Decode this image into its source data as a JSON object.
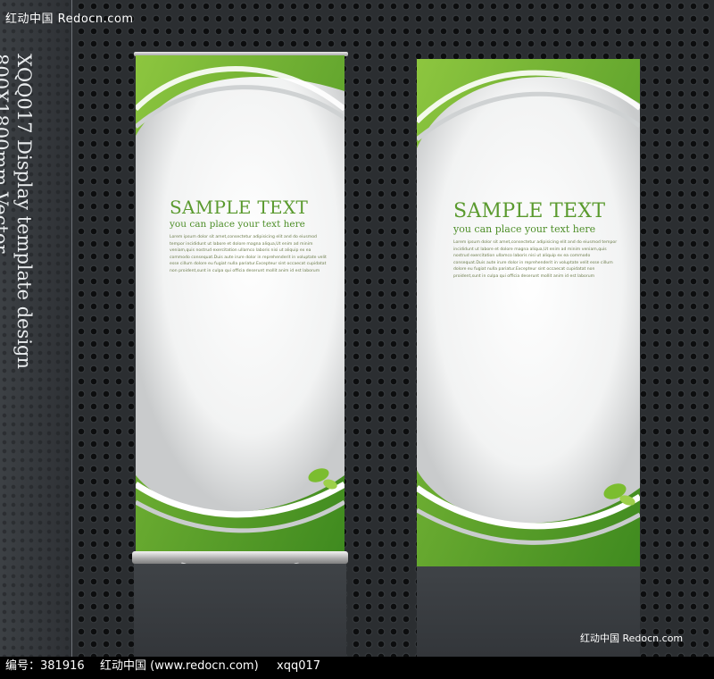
{
  "watermark_top": "红动中国 Redocn.com",
  "vertical_title": [
    "XQQ017 Display template design",
    "800X1800mm Vector"
  ],
  "banners": [
    {
      "title": "SAMPLE TEXT",
      "subtitle": "you can place your text here",
      "body": "Lorem ipsum dolor sit amet,consectetur adipisicing elit and do eiusmod tempor incididunt ut labore et dolore magna aliqua,Ut enim ad minim veniam,quis nostrud exercitation ullamco laboris nisi ut aliquip ex ea commodo consequat.Duis aute irure dolor in reprehenderit in voluptate velit esse cillum dolore eu fugiat nulla pariatur.Excepteur sint occaecat cupidatat non proident,sunt in culpa qui officia deserunt mollit anim id est laborum"
    },
    {
      "title": "SAMPLE TEXT",
      "subtitle": "you can place your text here",
      "body": "Lorem ipsum dolor sit amet,consectetur adipisicing elit and do eiusmod tempor incididunt ut labore et dolore magna aliqua,Ut enim ad minim veniam,quis nostrud exercitation ullamco laboris nisi ut aliquip ex ea commodo consequat.Duis aute irure dolor in reprehenderit in voluptate velit esse cillum dolore eu fugiat nulla pariatur.Excepteur sint occaecat cupidatat non proident,sunt in culpa qui officia deserunt mollit anim id est laborum"
    }
  ],
  "watermark_bottom": "红动中国 Redocn.com",
  "footer": {
    "id_label": "编号：381916",
    "site": "红动中国 (www.redocn.com)",
    "code": "xqq017"
  },
  "colors": {
    "green_dark": "#3f8a1f",
    "green_light": "#8dc63f",
    "title_green": "#5a9a2e",
    "panel_white": "#ffffff",
    "background": "#2b2e31"
  }
}
